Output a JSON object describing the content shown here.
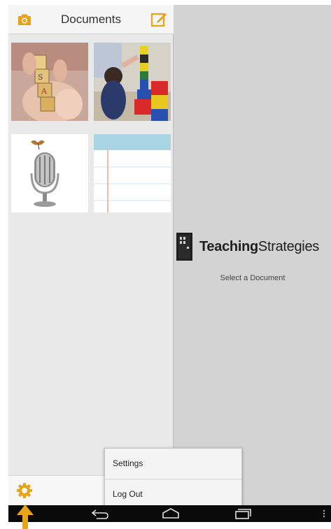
{
  "header": {
    "title": "Documents",
    "camera_icon": "camera-icon",
    "compose_icon": "compose-icon"
  },
  "documents": [
    {
      "name": "photo-child-blocks"
    },
    {
      "name": "photo-child-tower"
    },
    {
      "name": "audio-microphone"
    },
    {
      "name": "note-lined-paper"
    }
  ],
  "brand": {
    "name_bold": "Teaching",
    "name_regular": "Strategies"
  },
  "empty_message": "Select a Document",
  "menu": {
    "settings_label": "Settings",
    "logout_label": "Log Out"
  },
  "settings_icon": "gear-icon",
  "nav": {
    "back_icon": "back-icon",
    "home_icon": "home-icon",
    "recent_icon": "recent-apps-icon",
    "menu_icon": "overflow-menu-icon"
  },
  "colors": {
    "accent": "#e8a317",
    "panel_bg": "#e9e9e9",
    "pane_bg": "#d3d3d3",
    "nav_bg": "#0a0a0a"
  }
}
